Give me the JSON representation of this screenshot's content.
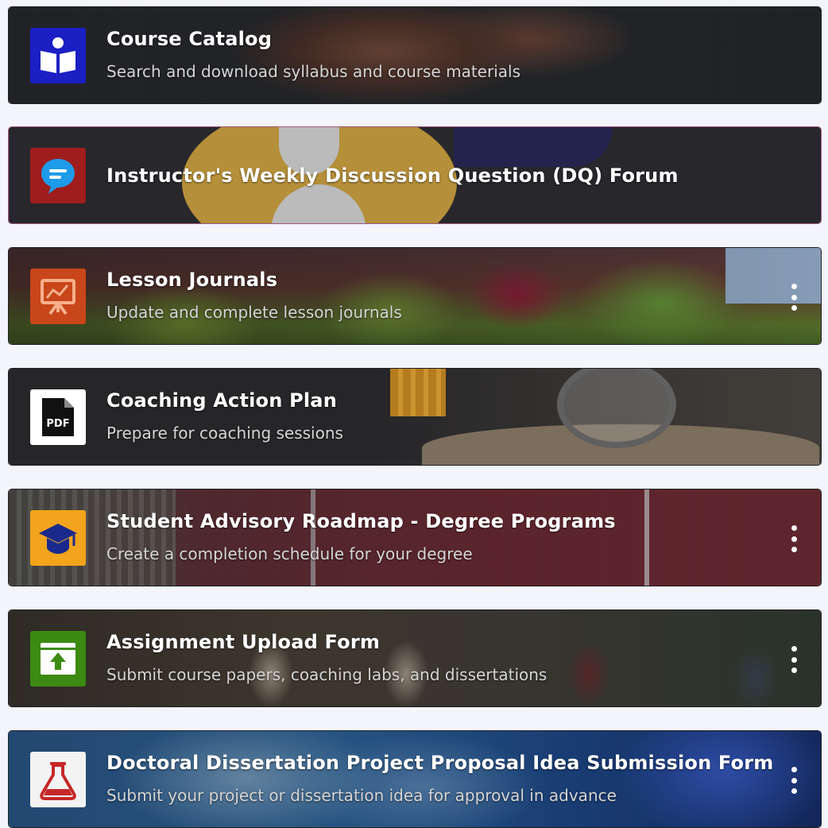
{
  "cards": [
    {
      "title": "Course Catalog",
      "subtitle": "Search and download syllabus and course materials",
      "icon": "open-book-reader-icon",
      "icon_bg": "#1b1fc4",
      "has_menu": false
    },
    {
      "title": "Instructor's Weekly Discussion Question (DQ) Forum",
      "subtitle": "",
      "icon": "chat-bubble-icon",
      "icon_bg": "#9f1d1d",
      "has_menu": false
    },
    {
      "title": "Lesson Journals",
      "subtitle": "Update and complete lesson journals",
      "icon": "presentation-board-icon",
      "icon_bg": "#c8461a",
      "has_menu": true
    },
    {
      "title": "Coaching Action Plan",
      "subtitle": "Prepare for coaching sessions",
      "icon": "pdf-file-icon",
      "icon_bg": "#ffffff",
      "has_menu": false
    },
    {
      "title": "Student Advisory Roadmap - Degree Programs",
      "subtitle": "Create a completion schedule for your degree",
      "icon": "graduation-cap-icon",
      "icon_bg": "#f2a41c",
      "has_menu": true
    },
    {
      "title": "Assignment Upload Form",
      "subtitle": "Submit course papers, coaching labs, and dissertations",
      "icon": "upload-icon",
      "icon_bg": "#3c8a12",
      "has_menu": true
    },
    {
      "title": "Doctoral Dissertation Project Proposal Idea Submission Form",
      "subtitle": "Submit your project or dissertation idea for approval in advance",
      "icon": "flask-icon",
      "icon_bg": "#f3f3f3",
      "has_menu": true
    }
  ]
}
